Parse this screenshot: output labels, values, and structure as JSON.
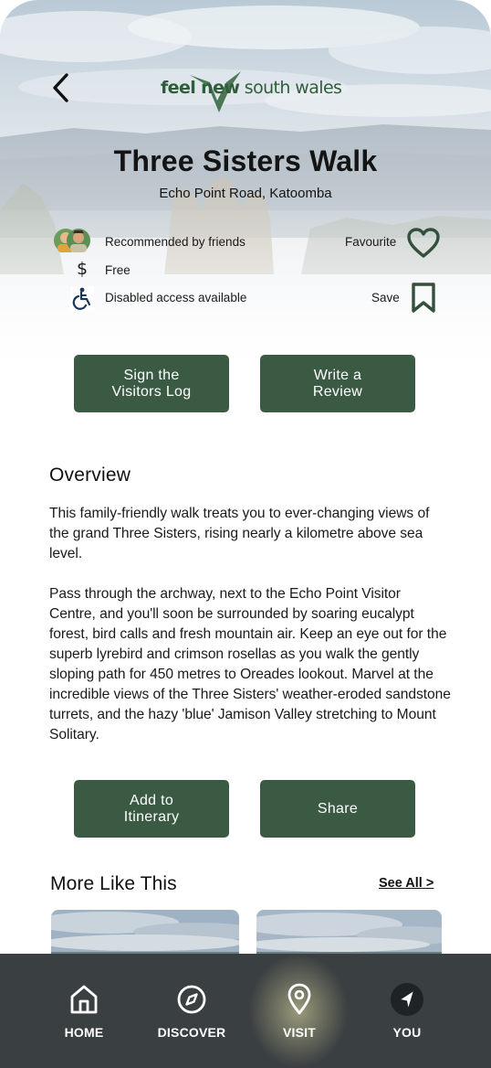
{
  "header": {
    "back_icon": "chevron-left-icon",
    "logo_text_bold": "feel new",
    "logo_text_light": "south wales"
  },
  "place": {
    "title": "Three Sisters Walk",
    "address": "Echo Point Road, Katoomba"
  },
  "info": {
    "recommended": "Recommended by friends",
    "price": "Free",
    "price_icon": "$",
    "access": "Disabled access available",
    "favourite_label": "Favourite",
    "save_label": "Save"
  },
  "actions_top": {
    "visitors_log": "Sign the Visitors Log",
    "review": "Write a Review"
  },
  "overview": {
    "heading": "Overview",
    "para1": "This family-friendly walk treats you to ever-changing views of the grand Three Sisters, rising nearly a kilometre above sea level.",
    "para2": "Pass through the archway, next to the Echo Point Visitor Centre, and you'll soon be surrounded by soaring eucalypt forest, bird calls and fresh mountain air. Keep an eye out for the superb lyrebird and crimson rosellas as you walk the gently sloping path for 450 metres to Oreades lookout. Marvel at the incredible views of the Three Sisters' weather-eroded sandstone turrets, and the hazy 'blue' Jamison Valley stretching to Mount Solitary."
  },
  "actions_bottom": {
    "itinerary": "Add to Itinerary",
    "share": "Share"
  },
  "more": {
    "heading": "More Like This",
    "see_all": "See All >"
  },
  "tabbar": {
    "active": "VISIT",
    "tabs": [
      {
        "label": "HOME",
        "icon": "home-icon"
      },
      {
        "label": "DISCOVER",
        "icon": "compass-icon"
      },
      {
        "label": "VISIT",
        "icon": "map-pin-icon"
      },
      {
        "label": "YOU",
        "icon": "navigation-arrow-icon"
      }
    ]
  },
  "colors": {
    "primary_button": "#3b5a44",
    "tabbar_bg": "#3a3f41",
    "brand_green": "#2f5d3b"
  }
}
